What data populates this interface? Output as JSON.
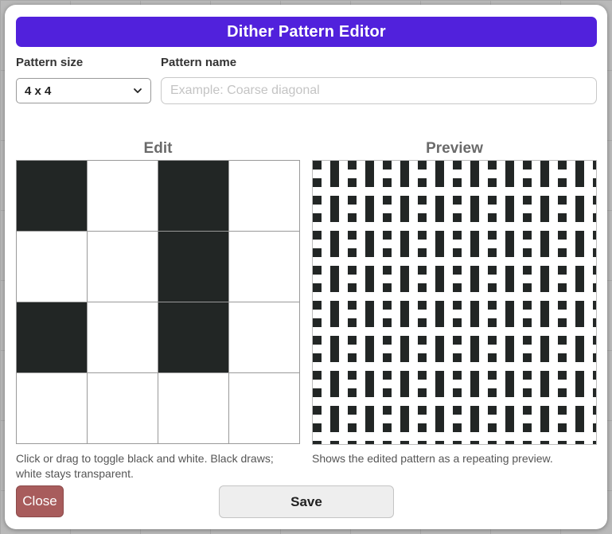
{
  "dialog": {
    "title": "Dither Pattern Editor",
    "accent_color": "#5121dc"
  },
  "pattern_size": {
    "label": "Pattern size",
    "selected": "4 x 4"
  },
  "pattern_name": {
    "label": "Pattern name",
    "placeholder": "Example: Coarse diagonal",
    "value": ""
  },
  "edit": {
    "heading": "Edit",
    "hint": "Click or drag to toggle black and white. Black draws; white stays transparent.",
    "grid": [
      [
        1,
        0,
        1,
        0
      ],
      [
        0,
        0,
        1,
        0
      ],
      [
        1,
        0,
        1,
        0
      ],
      [
        0,
        0,
        0,
        0
      ]
    ],
    "black_color": "#222625",
    "white_color": "#ffffff"
  },
  "preview": {
    "heading": "Preview",
    "hint": "Shows the edited pattern as a repeating preview."
  },
  "buttons": {
    "close_label": "Close",
    "save_label": "Save"
  }
}
